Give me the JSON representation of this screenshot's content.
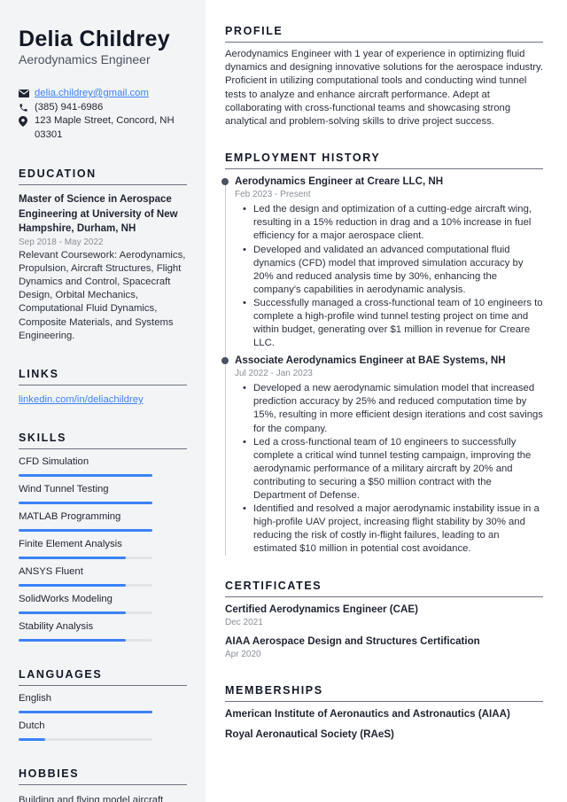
{
  "header": {
    "name": "Delia Childrey",
    "job_title": "Aerodynamics Engineer"
  },
  "contact": {
    "email": "delia.childrey@gmail.com",
    "phone": "(385) 941-6986",
    "address": "123 Maple Street, Concord, NH 03301",
    "icons": {
      "email": "envelope-icon",
      "phone": "phone-icon",
      "address": "map-pin-icon"
    }
  },
  "education": {
    "heading": "EDUCATION",
    "degree": "Master of Science in Aerospace Engineering at University of New Hampshire, Durham, NH",
    "dates": "Sep 2018 - May 2022",
    "description": "Relevant Coursework: Aerodynamics, Propulsion, Aircraft Structures, Flight Dynamics and Control, Spacecraft Design, Orbital Mechanics, Computational Fluid Dynamics, Composite Materials, and Systems Engineering."
  },
  "links": {
    "heading": "LINKS",
    "items": [
      "linkedin.com/in/deliachildrey"
    ]
  },
  "skills": {
    "heading": "SKILLS",
    "items": [
      {
        "label": "CFD Simulation",
        "level": 1.0
      },
      {
        "label": "Wind Tunnel Testing",
        "level": 1.0
      },
      {
        "label": "MATLAB Programming",
        "level": 1.0
      },
      {
        "label": "Finite Element Analysis",
        "level": 0.8
      },
      {
        "label": "ANSYS Fluent",
        "level": 0.8
      },
      {
        "label": "SolidWorks Modeling",
        "level": 0.8
      },
      {
        "label": "Stability Analysis",
        "level": 0.8
      }
    ]
  },
  "languages": {
    "heading": "LANGUAGES",
    "items": [
      {
        "label": "English",
        "level": 1.0
      },
      {
        "label": "Dutch",
        "level": 0.2
      }
    ]
  },
  "hobbies": {
    "heading": "HOBBIES",
    "text": "Building and flying model aircraft"
  },
  "profile": {
    "heading": "PROFILE",
    "text": "Aerodynamics Engineer with 1 year of experience in optimizing fluid dynamics and designing innovative solutions for the aerospace industry. Proficient in utilizing computational tools and conducting wind tunnel tests to analyze and enhance aircraft performance. Adept at collaborating with cross-functional teams and showcasing strong analytical and problem-solving skills to drive project success."
  },
  "employment": {
    "heading": "EMPLOYMENT HISTORY",
    "jobs": [
      {
        "title": "Aerodynamics Engineer at Creare LLC, NH",
        "dates": "Feb 2023 - Present",
        "bullets": [
          "Led the design and optimization of a cutting-edge aircraft wing, resulting in a 15% reduction in drag and a 10% increase in fuel efficiency for a major aerospace client.",
          "Developed and validated an advanced computational fluid dynamics (CFD) model that improved simulation accuracy by 20% and reduced analysis time by 30%, enhancing the company's capabilities in aerodynamic analysis.",
          "Successfully managed a cross-functional team of 10 engineers to complete a high-profile wind tunnel testing project on time and within budget, generating over $1 million in revenue for Creare LLC."
        ]
      },
      {
        "title": "Associate Aerodynamics Engineer at BAE Systems, NH",
        "dates": "Jul 2022 - Jan 2023",
        "bullets": [
          "Developed a new aerodynamic simulation model that increased prediction accuracy by 25% and reduced computation time by 15%, resulting in more efficient design iterations and cost savings for the company.",
          "Led a cross-functional team of 10 engineers to successfully complete a critical wind tunnel testing campaign, improving the aerodynamic performance of a military aircraft by 20% and contributing to securing a $50 million contract with the Department of Defense.",
          "Identified and resolved a major aerodynamic instability issue in a high-profile UAV project, increasing flight stability by 30% and reducing the risk of costly in-flight failures, leading to an estimated $10 million in potential cost avoidance."
        ]
      }
    ]
  },
  "certificates": {
    "heading": "CERTIFICATES",
    "items": [
      {
        "name": "Certified Aerodynamics Engineer (CAE)",
        "date": "Dec 2021"
      },
      {
        "name": "AIAA Aerospace Design and Structures Certification",
        "date": "Apr 2020"
      }
    ]
  },
  "memberships": {
    "heading": "MEMBERSHIPS",
    "items": [
      "American Institute of Aeronautics and Astronautics (AIAA)",
      "Royal Aeronautical Society (RAeS)"
    ]
  },
  "colors": {
    "sidebar_bg": "#f3f4f6",
    "accent": "#3b82f6",
    "text": "#1f2433",
    "muted": "#8a8f99"
  }
}
